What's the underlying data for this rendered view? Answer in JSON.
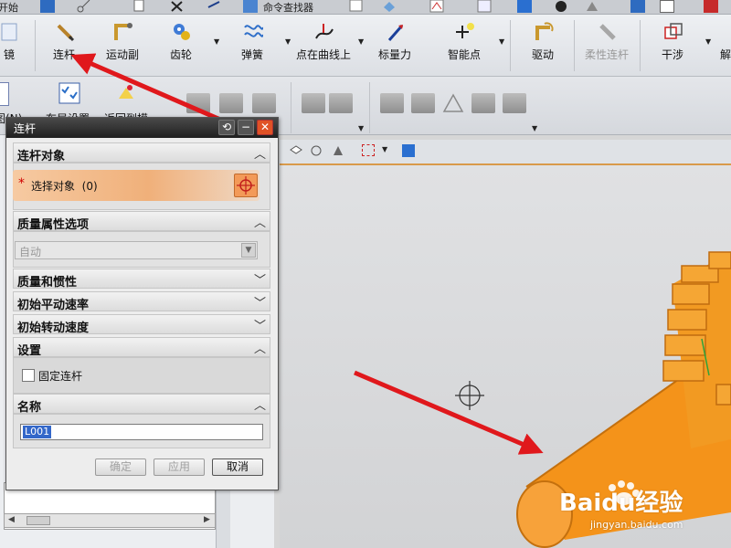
{
  "top_strip": {
    "left_label": "开始",
    "command_finder": "命令查找器"
  },
  "toolbar": {
    "left_partial": "镜",
    "buttons": [
      {
        "label": "连杆"
      },
      {
        "label": "运动副"
      },
      {
        "label": "齿轮"
      },
      {
        "label": "弹簧"
      },
      {
        "label": "点在曲线上"
      },
      {
        "label": "标量力"
      },
      {
        "label": "智能点"
      },
      {
        "label": "驱动"
      },
      {
        "label": "柔性连杆"
      },
      {
        "label": "干涉"
      }
    ],
    "right_partial": "解"
  },
  "toolbar2": {
    "labels": [
      "图(N)",
      "布局设置",
      "返回到模"
    ]
  },
  "dialog": {
    "title": "连杆",
    "sections": {
      "link_object": "连杆对象",
      "mass_property_options": "质量属性选项",
      "mass_and_inertia": "质量和惯性",
      "initial_translational_velocity": "初始平动速率",
      "initial_rotational_velocity": "初始转动速度",
      "settings": "设置",
      "name": "名称"
    },
    "select_object": {
      "required_marker": "*",
      "label": "选择对象",
      "count": "(0)"
    },
    "mass_mode": "自动",
    "fix_link_label": "固定连杆",
    "name_value": "L001",
    "buttons": {
      "ok": "确定",
      "apply": "应用",
      "cancel": "取消"
    }
  },
  "watermark": {
    "logo": "Baidu经验",
    "url": "jingyan.baidu.com"
  },
  "colors": {
    "accent_orange": "#f0a068",
    "gear_orange": "#f59a1c",
    "arrow_red": "#e0181c",
    "title_bar": "#2a2a2a"
  }
}
